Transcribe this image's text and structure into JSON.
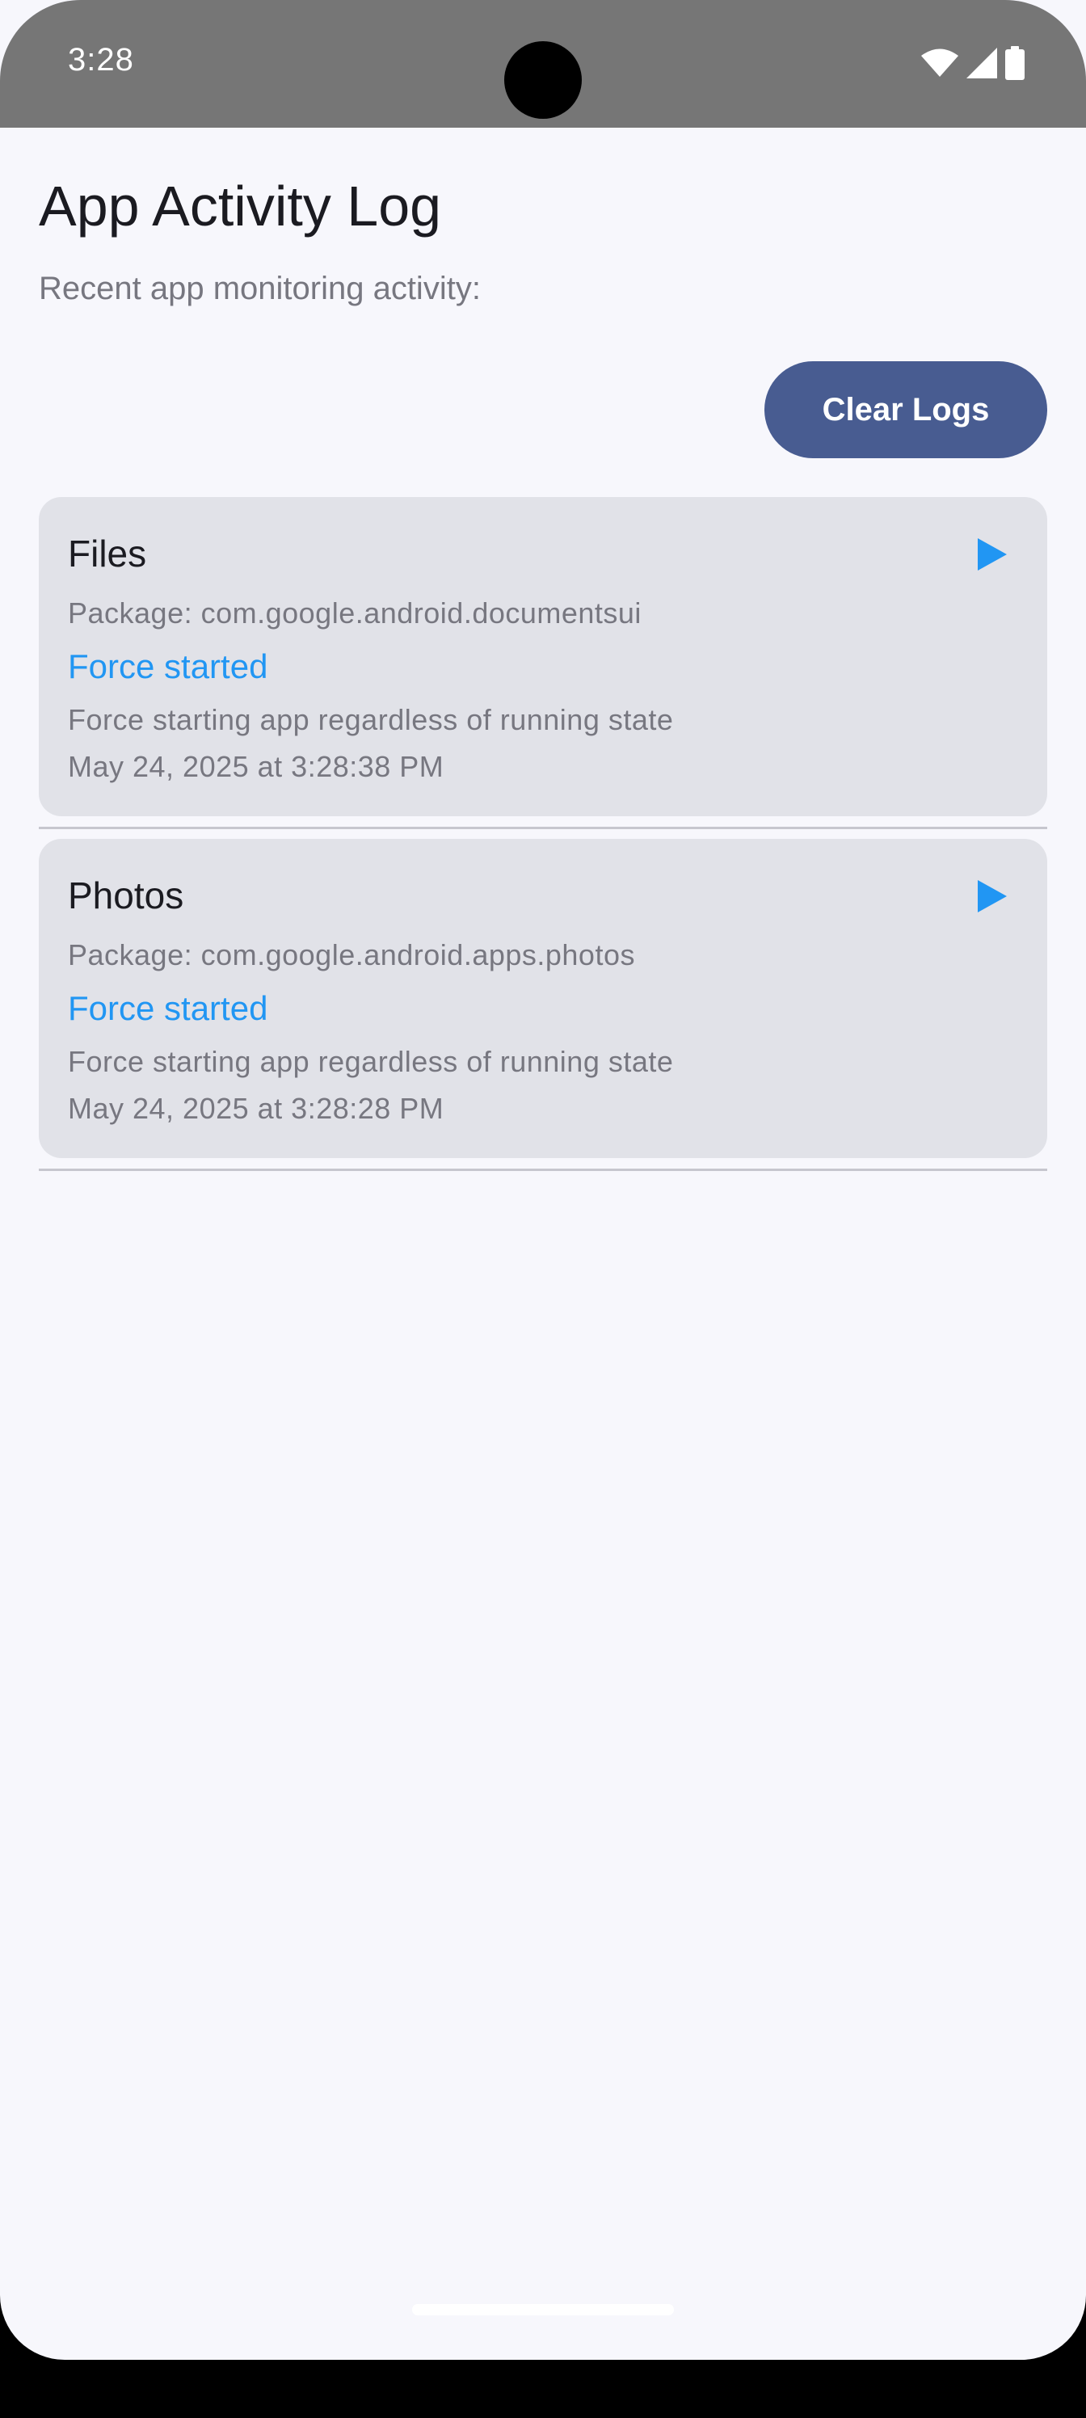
{
  "status_bar": {
    "time": "3:28",
    "icons": [
      "wifi-icon",
      "cellular-signal-icon",
      "battery-icon"
    ],
    "background_color": "#767676"
  },
  "header": {
    "title": "App Activity Log",
    "subtitle": "Recent app monitoring activity:"
  },
  "actions": {
    "clear_label": "Clear Logs",
    "button_color": "#485C91"
  },
  "logs": [
    {
      "app_name": "Files",
      "package": "Package: com.google.android.documentsui",
      "status": "Force started",
      "description": "Force starting app regardless of running state",
      "timestamp": "May 24, 2025 at 3:28:38 PM",
      "icon": "play-icon"
    },
    {
      "app_name": "Photos",
      "package": "Package: com.google.android.apps.photos",
      "status": "Force started",
      "description": "Force starting app regardless of running state",
      "timestamp": "May 24, 2025 at 3:28:28 PM",
      "icon": "play-icon"
    }
  ],
  "colors": {
    "accent": "#2196F3",
    "background": "#F7F7FC",
    "card": "#E1E2E8"
  }
}
